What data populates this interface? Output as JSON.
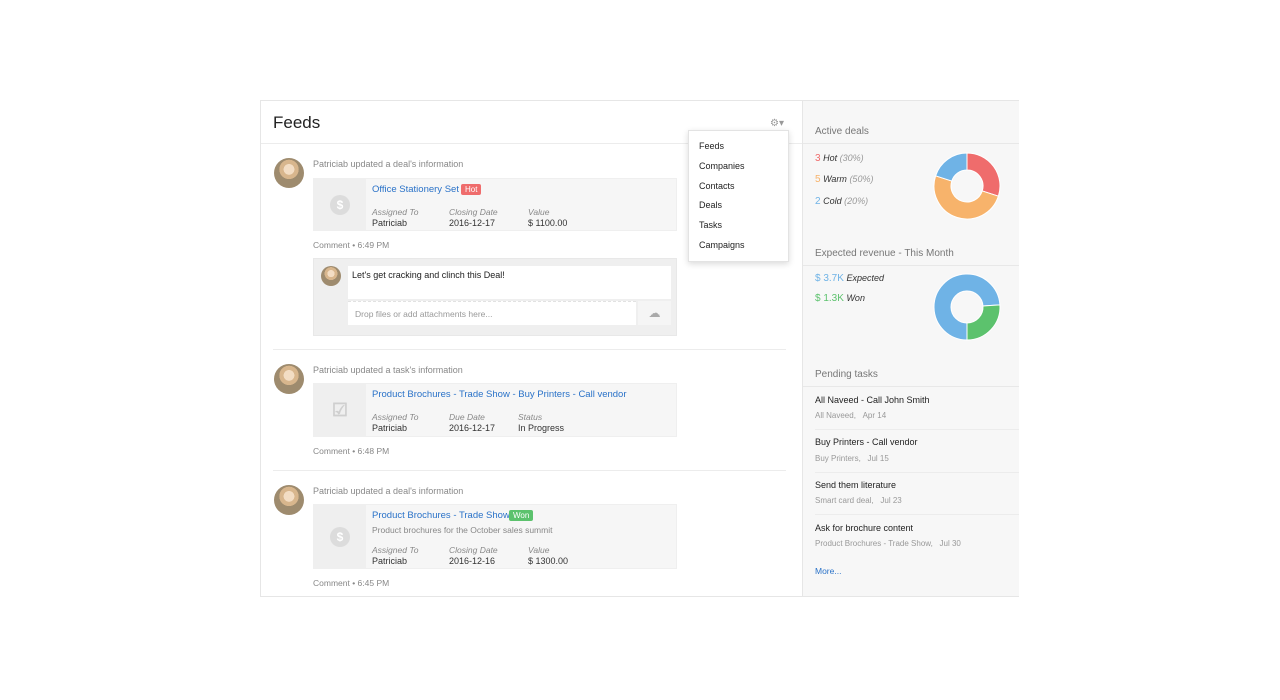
{
  "feeds": {
    "title": "Feeds",
    "gear_icon": "gear-icon",
    "dropdown": [
      "Feeds",
      "Companies",
      "Contacts",
      "Deals",
      "Tasks",
      "Campaigns"
    ],
    "items": [
      {
        "meta": "Patriciab updated a deal's information",
        "title": "Office Stationery Set",
        "badge": "Hot",
        "fields": [
          {
            "label": "Assigned To",
            "value": "Patriciab"
          },
          {
            "label": "Closing Date",
            "value": "2016-12-17"
          },
          {
            "label": "Value",
            "value": "$ 1100.00"
          }
        ],
        "comment": "Comment",
        "time": "6:49 PM"
      },
      {
        "meta": "Patriciab updated a task's information",
        "title": "Product Brochures - Trade Show - Buy Printers - Call vendor",
        "fields": [
          {
            "label": "Assigned To",
            "value": "Patriciab"
          },
          {
            "label": "Due Date",
            "value": "2016-12-17"
          },
          {
            "label": "Status",
            "value": "In Progress"
          }
        ],
        "comment": "Comment",
        "time": "6:48 PM"
      },
      {
        "meta": "Patriciab updated a deal's information",
        "title": "Product Brochures - Trade Show",
        "badge": "Won",
        "description": "Product brochures for the October sales summit",
        "fields": [
          {
            "label": "Assigned To",
            "value": "Patriciab"
          },
          {
            "label": "Closing Date",
            "value": "2016-12-16"
          },
          {
            "label": "Value",
            "value": "$ 1300.00"
          }
        ],
        "comment": "Comment",
        "time": "6:45 PM"
      }
    ],
    "comment_box": {
      "text": "Let's get cracking and clinch this Deal!",
      "attach_placeholder": "Drop files or add attachments here..."
    }
  },
  "sidebar": {
    "active_deals": {
      "title": "Active deals",
      "rows": [
        {
          "count": "3",
          "name": "Hot",
          "pct": "(30%)",
          "color": "#ef6c6c"
        },
        {
          "count": "5",
          "name": "Warm",
          "pct": "(50%)",
          "color": "#f7b36b"
        },
        {
          "count": "2",
          "name": "Cold",
          "pct": "(20%)",
          "color": "#6fb3e6"
        }
      ]
    },
    "expected_revenue": {
      "title": "Expected revenue - This Month",
      "rows": [
        {
          "value": "$ 3.7K",
          "name": "Expected",
          "color": "#6fb3e6"
        },
        {
          "value": "$ 1.3K",
          "name": "Won",
          "color": "#5cc26d"
        }
      ]
    },
    "pending_tasks": {
      "title": "Pending tasks",
      "items": [
        {
          "title": "All Naveed - Call John Smith",
          "context": "All Naveed,",
          "date": "Apr 14"
        },
        {
          "title": "Buy Printers - Call vendor",
          "context": "Buy Printers,",
          "date": "Jul 15"
        },
        {
          "title": "Send them literature",
          "context": "Smart card deal,",
          "date": "Jul 23"
        },
        {
          "title": "Ask for brochure content",
          "context": "Product Brochures - Trade Show,",
          "date": "Jul 30"
        }
      ],
      "more": "More..."
    }
  },
  "chart_data": [
    {
      "type": "pie",
      "title": "Active deals",
      "categories": [
        "Hot",
        "Warm",
        "Cold"
      ],
      "values": [
        30,
        50,
        20
      ],
      "colors": [
        "#ef6c6c",
        "#f7b36b",
        "#6fb3e6"
      ],
      "donut": true
    },
    {
      "type": "pie",
      "title": "Expected revenue - This Month",
      "categories": [
        "Expected",
        "Won"
      ],
      "values": [
        3.7,
        1.3
      ],
      "colors": [
        "#6fb3e6",
        "#5cc26d"
      ],
      "donut": true
    }
  ]
}
